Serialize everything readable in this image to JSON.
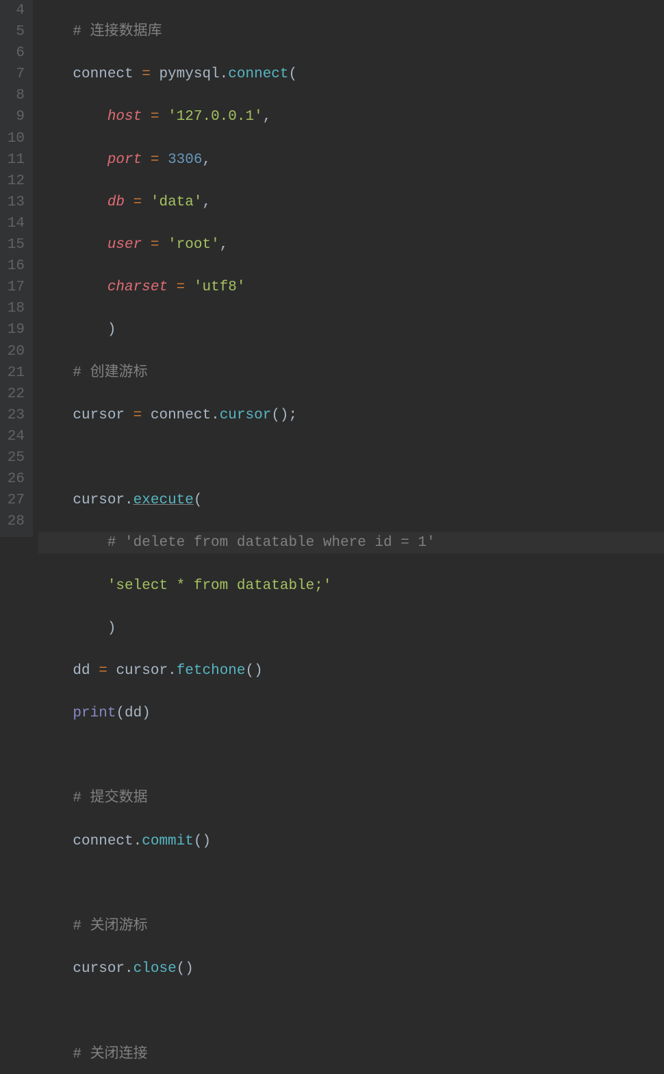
{
  "lineNumbers": [
    "4",
    "5",
    "6",
    "7",
    "8",
    "9",
    "10",
    "11",
    "12",
    "13",
    "14",
    "15",
    "16",
    "17",
    "18",
    "19",
    "20",
    "21",
    "22",
    "23",
    "24",
    "25",
    "26",
    "27",
    "28"
  ],
  "code": {
    "l4": {
      "comment_hash": "# ",
      "comment_text": "连接数据库"
    },
    "l5": {
      "var": "connect",
      "eq": " = ",
      "mod": "pymysql",
      "dot": ".",
      "fn": "connect",
      "open": "("
    },
    "l6": {
      "param": "host",
      "eq": " = ",
      "str": "'127.0.0.1'",
      "comma": ","
    },
    "l7": {
      "param": "port",
      "eq": " = ",
      "num": "3306",
      "comma": ","
    },
    "l8": {
      "param": "db",
      "eq": " = ",
      "str": "'data'",
      "comma": ","
    },
    "l9": {
      "param": "user",
      "eq": " = ",
      "str": "'root'",
      "comma": ","
    },
    "l10": {
      "param": "charset",
      "eq": " = ",
      "str": "'utf8'"
    },
    "l11": {
      "close": ")"
    },
    "l12": {
      "comment_hash": "# ",
      "comment_text": "创建游标"
    },
    "l13": {
      "var": "cursor",
      "eq": " = ",
      "obj": "connect",
      "dot": ".",
      "fn": "cursor",
      "call": "();"
    },
    "l15": {
      "obj": "cursor",
      "dot": ".",
      "fn": "execute",
      "open": "("
    },
    "l16": {
      "comment": "# 'delete from datatable where id = 1'"
    },
    "l17": {
      "str": "'select * from datatable;'"
    },
    "l18": {
      "close": ")"
    },
    "l19": {
      "var": "dd",
      "eq": " = ",
      "obj": "cursor",
      "dot": ".",
      "fn": "fetchone",
      "call": "()"
    },
    "l20": {
      "fn": "print",
      "open": "(",
      "arg": "dd",
      "close": ")"
    },
    "l22": {
      "comment_hash": "# ",
      "comment_text": "提交数据"
    },
    "l23": {
      "obj": "connect",
      "dot": ".",
      "fn": "commit",
      "call": "()"
    },
    "l25": {
      "comment_hash": "# ",
      "comment_text": "关闭游标"
    },
    "l26": {
      "obj": "cursor",
      "dot": ".",
      "fn": "close",
      "call": "()"
    },
    "l28": {
      "comment_hash": "# ",
      "comment_text": "关闭连接"
    }
  }
}
